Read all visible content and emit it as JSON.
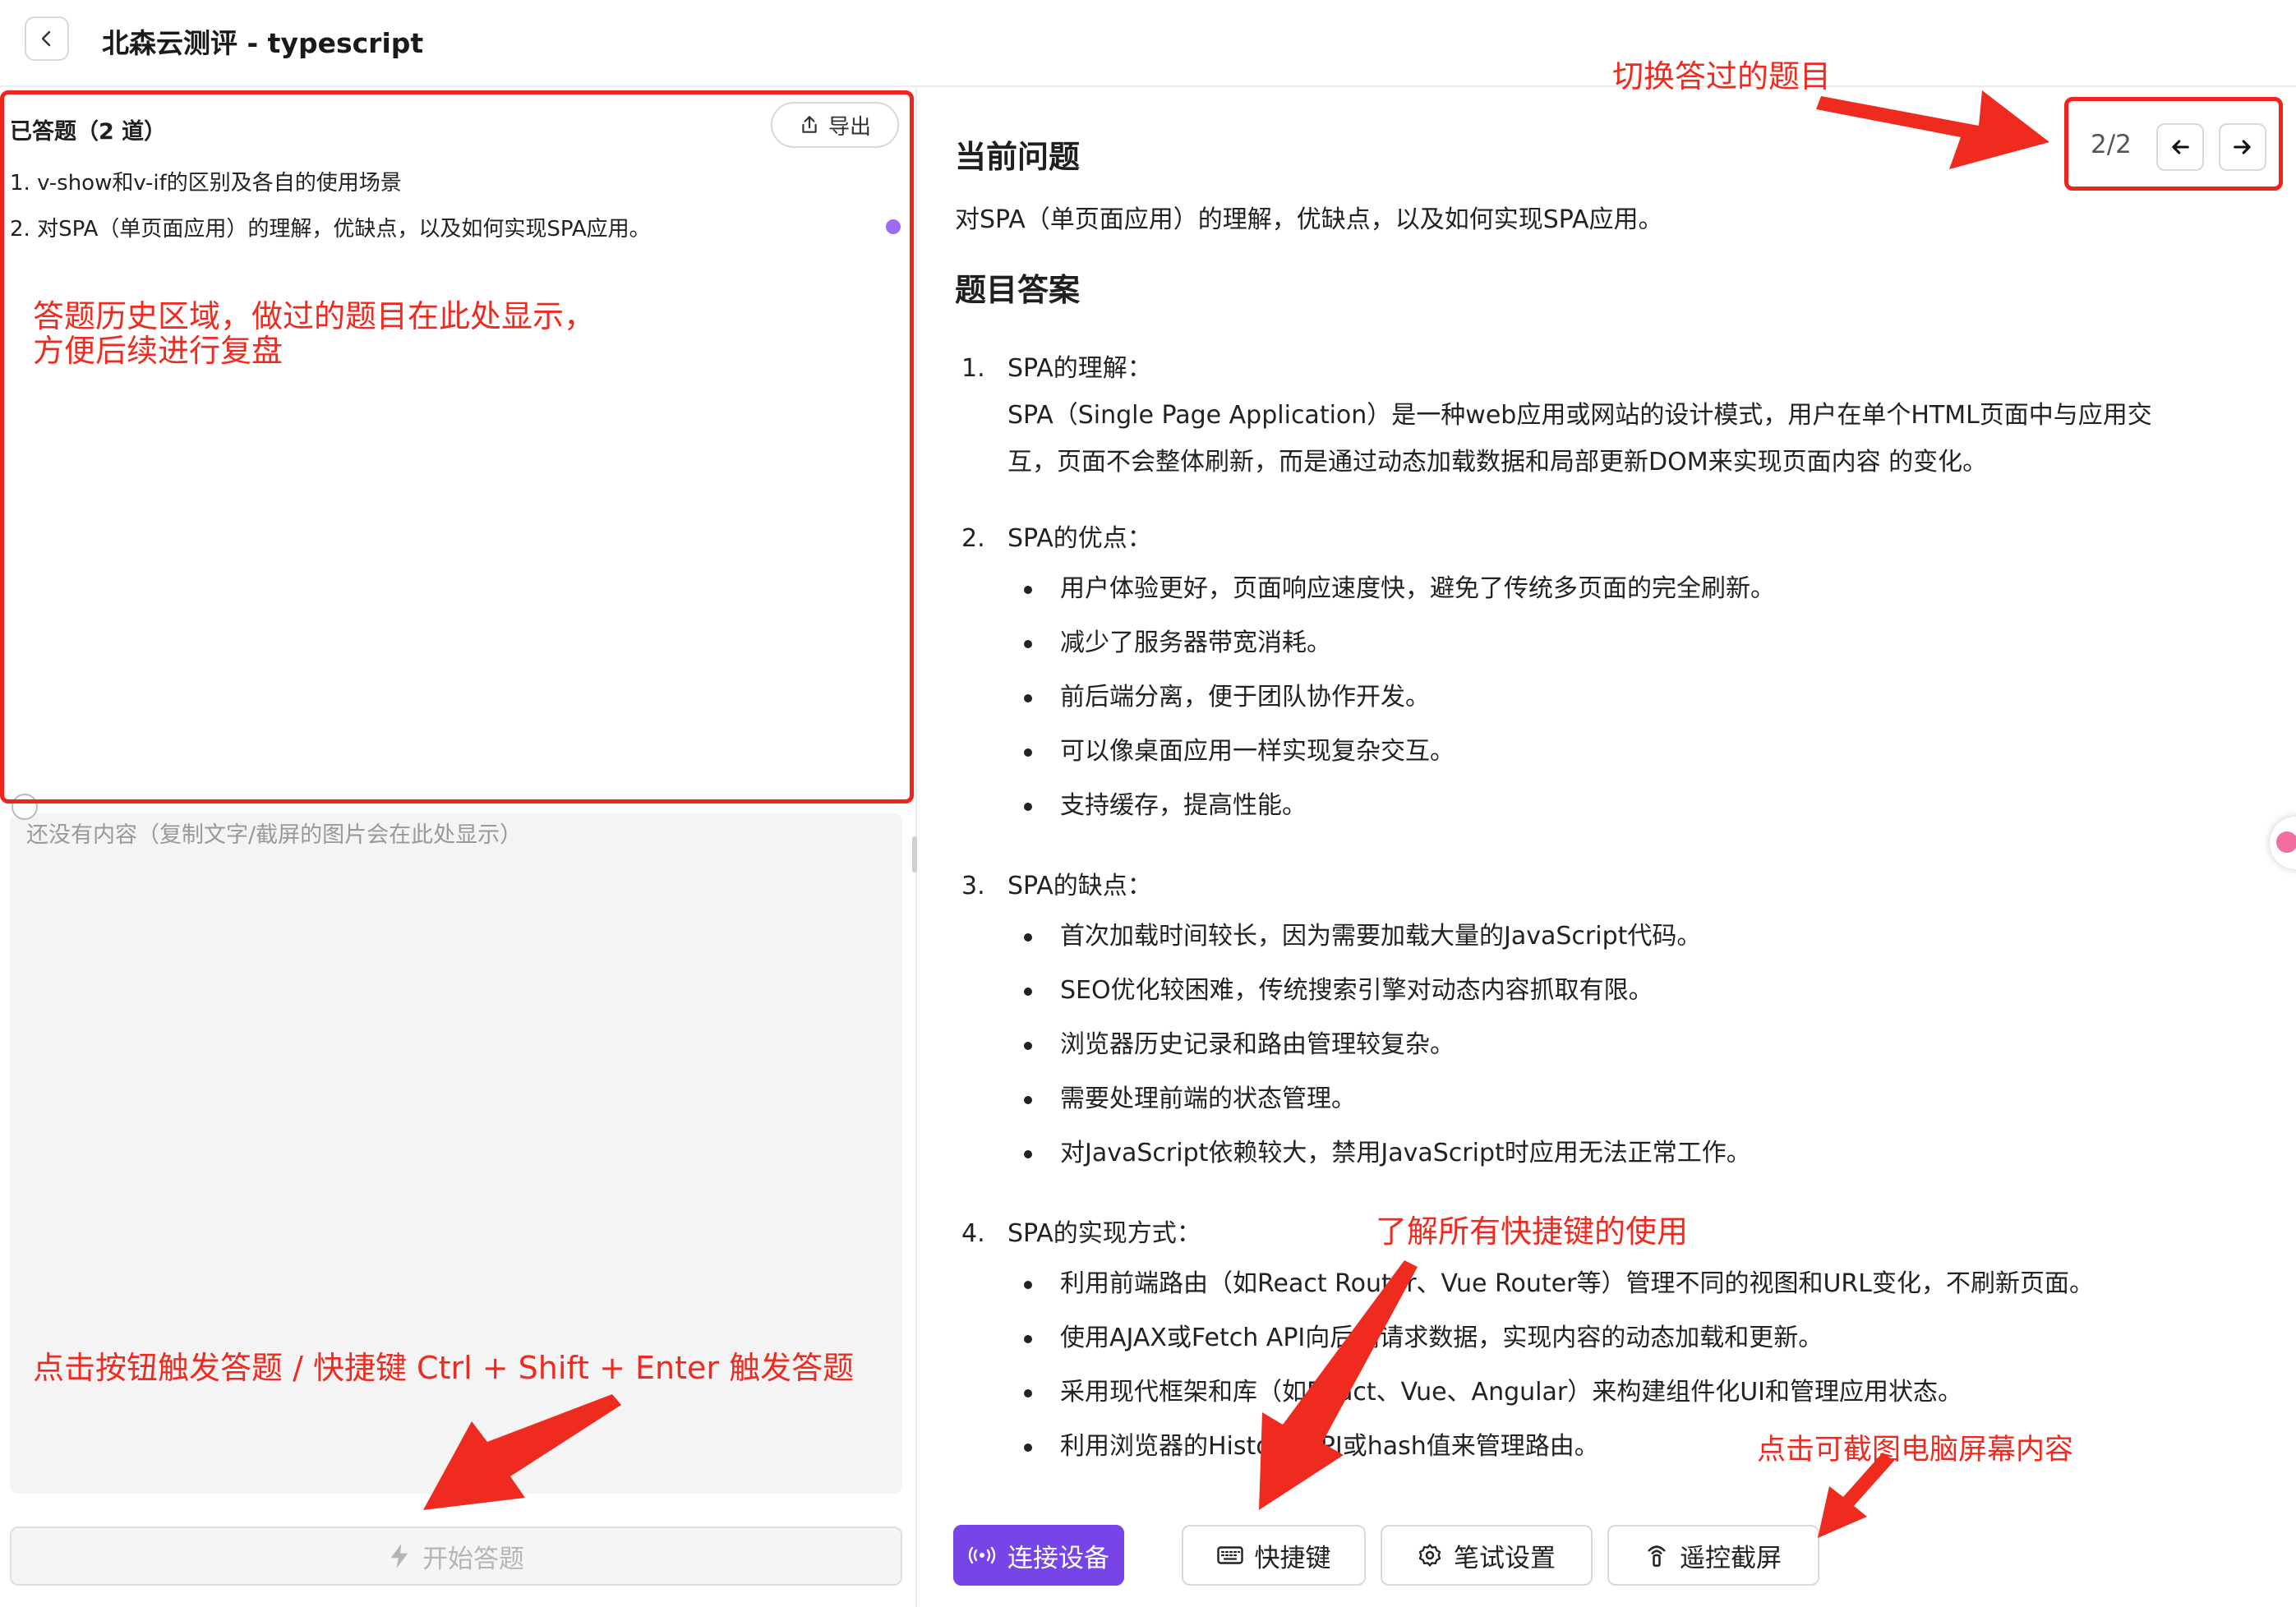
{
  "header": {
    "title": "北森云测评 - typescript"
  },
  "history": {
    "title": "已答题（2 道）",
    "export_label": "导出",
    "items": [
      "1. v-show和v-if的区别及各自的使用场景",
      "2. 对SPA（单页面应用）的理解，优缺点，以及如何实现SPA应用。"
    ]
  },
  "input": {
    "placeholder": "还没有内容（复制文字/截屏的图片会在此处显示）"
  },
  "start_button": {
    "label": "开始答题"
  },
  "question": {
    "title": "当前问题",
    "text": "对SPA（单页面应用）的理解，优缺点，以及如何实现SPA应用。",
    "pager": "2/2"
  },
  "answer": {
    "title": "题目答案",
    "sections": [
      {
        "num": "1.",
        "heading": "SPA的理解：",
        "paragraph": [
          "SPA（Single Page Application）是一种web应用或网站的设计模式，用户在单个HTML页面中与应用交",
          "互，页面不会整体刷新，而是通过动态加载数据和局部更新DOM来实现页面内容 的变化。"
        ]
      },
      {
        "num": "2.",
        "heading": "SPA的优点：",
        "bullets": [
          "用户体验更好，页面响应速度快，避免了传统多页面的完全刷新。",
          "减少了服务器带宽消耗。",
          "前后端分离，便于团队协作开发。",
          "可以像桌面应用一样实现复杂交互。",
          "支持缓存，提高性能。"
        ]
      },
      {
        "num": "3.",
        "heading": "SPA的缺点：",
        "bullets": [
          "首次加载时间较长，因为需要加载大量的JavaScript代码。",
          "SEO优化较困难，传统搜索引擎对动态内容抓取有限。",
          "浏览器历史记录和路由管理较复杂。",
          "需要处理前端的状态管理。",
          "对JavaScript依赖较大，禁用JavaScript时应用无法正常工作。"
        ]
      },
      {
        "num": "4.",
        "heading": "SPA的实现方式：",
        "bullets": [
          "利用前端路由（如React Router、Vue Router等）管理不同的视图和URL变化，不刷新页面。",
          "使用AJAX或Fetch API向后端请求数据，实现内容的动态加载和更新。",
          "采用现代框架和库（如React、Vue、Angular）来构建组件化UI和管理应用状态。",
          "利用浏览器的History API或hash值来管理路由。"
        ]
      }
    ]
  },
  "toolbar": {
    "connect": "连接设备",
    "shortcuts": "快捷键",
    "settings": "笔试设置",
    "screenshot": "遥控截屏"
  },
  "annotations": {
    "switch": "切换答过的题目",
    "history_1": "答题历史区域，做过的题目在此处显示，",
    "history_2": "方便后续进行复盘",
    "trigger": "点击按钮触发答题 / 快捷键 Ctrl + Shift + Enter 触发答题",
    "shortcuts": "了解所有快捷键的使用",
    "capture": "点击可截图电脑屏幕内容"
  },
  "colors": {
    "primary": "#7744e8",
    "annotation": "#ef2a1f",
    "dot": "#9b6cf2"
  }
}
